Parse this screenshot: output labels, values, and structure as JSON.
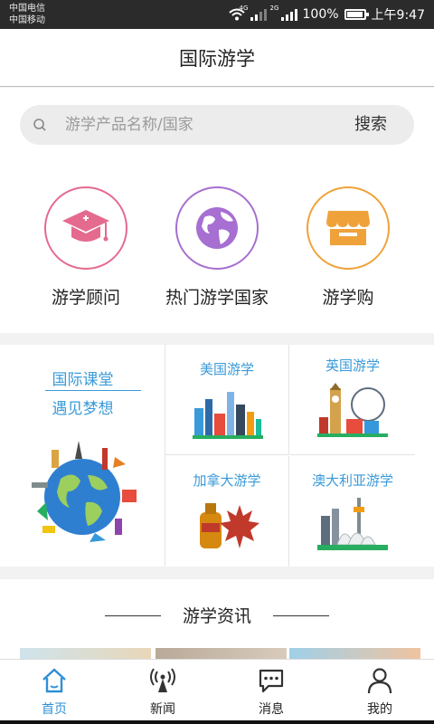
{
  "status_bar": {
    "carrier1": "中国电信",
    "carrier2": "中国移动",
    "net1": "4G",
    "net2": "2G",
    "battery": "100%",
    "time": "上午9:47"
  },
  "header": {
    "title": "国际游学"
  },
  "search": {
    "placeholder": "游学产品名称/国家",
    "button": "搜索"
  },
  "quick_links": [
    {
      "label": "游学顾问",
      "icon": "graduation-cap-icon",
      "color": "#e46a8e"
    },
    {
      "label": "热门游学国家",
      "icon": "globe-icon",
      "color": "#a66fd1"
    },
    {
      "label": "游学购",
      "icon": "shop-icon",
      "color": "#f0a23a"
    }
  ],
  "feature": {
    "line1": "国际课堂",
    "line2": "遇见梦想"
  },
  "destinations": [
    {
      "label": "美国游学"
    },
    {
      "label": "英国游学"
    },
    {
      "label": "加拿大游学"
    },
    {
      "label": "澳大利亚游学"
    }
  ],
  "news": {
    "title": "游学资讯"
  },
  "tabs": [
    {
      "label": "首页",
      "icon": "home-icon",
      "active": true
    },
    {
      "label": "新闻",
      "icon": "antenna-icon",
      "active": false
    },
    {
      "label": "消息",
      "icon": "chat-icon",
      "active": false
    },
    {
      "label": "我的",
      "icon": "user-icon",
      "active": false
    }
  ],
  "colors": {
    "accent": "#2f8fd6",
    "link_blue": "#3a9ad9"
  }
}
